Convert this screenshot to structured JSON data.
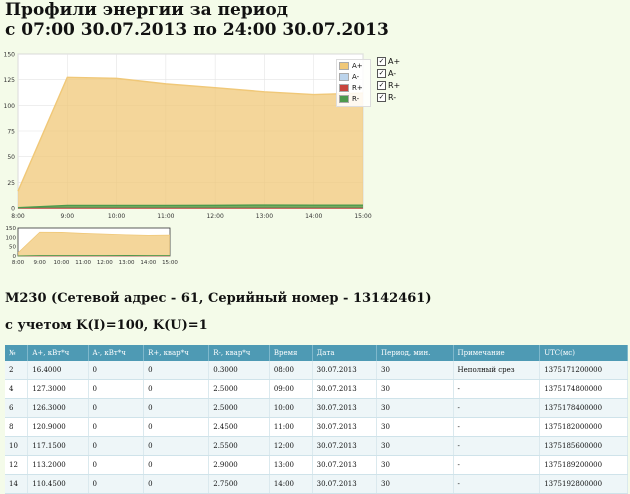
{
  "page": {
    "title_line1": "Профили энергии за период",
    "title_line2": "с 07:00 30.07.2013 по 24:00 30.07.2013",
    "meter_heading": "М230 (Сетевой адрес - 61, Серийный номер - 13142461)",
    "ratio_heading": "с учетом K(I)=100, K(U)=1"
  },
  "legend": {
    "items": [
      {
        "label": "A+",
        "color": "#f0c878"
      },
      {
        "label": "A-",
        "color": "#bcd4ec"
      },
      {
        "label": "R+",
        "color": "#c8443c"
      },
      {
        "label": "R-",
        "color": "#4c9a4c"
      }
    ]
  },
  "series_toggles": [
    {
      "label": "A+",
      "mark": "✓"
    },
    {
      "label": "A-",
      "mark": "✓"
    },
    {
      "label": "R+",
      "mark": "✓"
    },
    {
      "label": "R-",
      "mark": "✓"
    }
  ],
  "chart_data": {
    "type": "area",
    "x": [
      "8:00",
      "9:00",
      "10:00",
      "11:00",
      "12:00",
      "13:00",
      "14:00",
      "15:00"
    ],
    "yticks": [
      0,
      25,
      50,
      75,
      100,
      125,
      150
    ],
    "ylim": [
      0,
      150
    ],
    "series": [
      {
        "name": "A+",
        "color": "#f0c878",
        "points": [
          [
            8.0,
            16.4
          ],
          [
            9.0,
            127.3
          ],
          [
            10.0,
            126.3
          ],
          [
            11.0,
            120.9
          ],
          [
            12.0,
            117.15
          ],
          [
            13.0,
            113.2
          ],
          [
            14.0,
            110.45
          ],
          [
            15.0,
            112.0
          ]
        ]
      },
      {
        "name": "A-",
        "color": "#bcd4ec",
        "points": [
          [
            8.0,
            0
          ],
          [
            9.0,
            0
          ],
          [
            10.0,
            0
          ],
          [
            11.0,
            0
          ],
          [
            12.0,
            0
          ],
          [
            13.0,
            0
          ],
          [
            14.0,
            0
          ],
          [
            15.0,
            0
          ]
        ]
      },
      {
        "name": "R+",
        "color": "#c8443c",
        "points": [
          [
            8.0,
            0
          ],
          [
            9.0,
            0
          ],
          [
            10.0,
            0
          ],
          [
            11.0,
            0
          ],
          [
            12.0,
            0
          ],
          [
            13.0,
            0
          ],
          [
            14.0,
            0
          ],
          [
            15.0,
            0
          ]
        ]
      },
      {
        "name": "R-",
        "color": "#4c9a4c",
        "points": [
          [
            8.0,
            0.3
          ],
          [
            9.0,
            2.5
          ],
          [
            10.0,
            2.5
          ],
          [
            11.0,
            2.45
          ],
          [
            12.0,
            2.55
          ],
          [
            13.0,
            2.9
          ],
          [
            14.0,
            2.75
          ],
          [
            15.0,
            2.75
          ]
        ]
      }
    ],
    "legend_position": "top-right",
    "grid": true
  },
  "overview_chart": {
    "yticks": [
      0,
      50,
      100,
      150
    ],
    "x": [
      "8:00",
      "9:00",
      "10:00",
      "11:00",
      "12:00",
      "13:00",
      "14:00",
      "15:00"
    ]
  },
  "table": {
    "headers": [
      "№",
      "A+, кВт*ч",
      "A-, кВт*ч",
      "R+, квар*ч",
      "R-, квар*ч",
      "Время",
      "Дата",
      "Период, мин.",
      "Примечание",
      "UTC(мс)"
    ],
    "rows": [
      [
        "2",
        "16.4000",
        "0",
        "0",
        "0.3000",
        "08:00",
        "30.07.2013",
        "30",
        "Неполный срез",
        "1375171200000"
      ],
      [
        "4",
        "127.3000",
        "0",
        "0",
        "2.5000",
        "09:00",
        "30.07.2013",
        "30",
        "-",
        "1375174800000"
      ],
      [
        "6",
        "126.3000",
        "0",
        "0",
        "2.5000",
        "10:00",
        "30.07.2013",
        "30",
        "-",
        "1375178400000"
      ],
      [
        "8",
        "120.9000",
        "0",
        "0",
        "2.4500",
        "11:00",
        "30.07.2013",
        "30",
        "-",
        "1375182000000"
      ],
      [
        "10",
        "117.1500",
        "0",
        "0",
        "2.5500",
        "12:00",
        "30.07.2013",
        "30",
        "-",
        "1375185600000"
      ],
      [
        "12",
        "113.2000",
        "0",
        "0",
        "2.9000",
        "13:00",
        "30.07.2013",
        "30",
        "-",
        "1375189200000"
      ],
      [
        "14",
        "110.4500",
        "0",
        "0",
        "2.7500",
        "14:00",
        "30.07.2013",
        "30",
        "-",
        "1375192800000"
      ]
    ]
  }
}
